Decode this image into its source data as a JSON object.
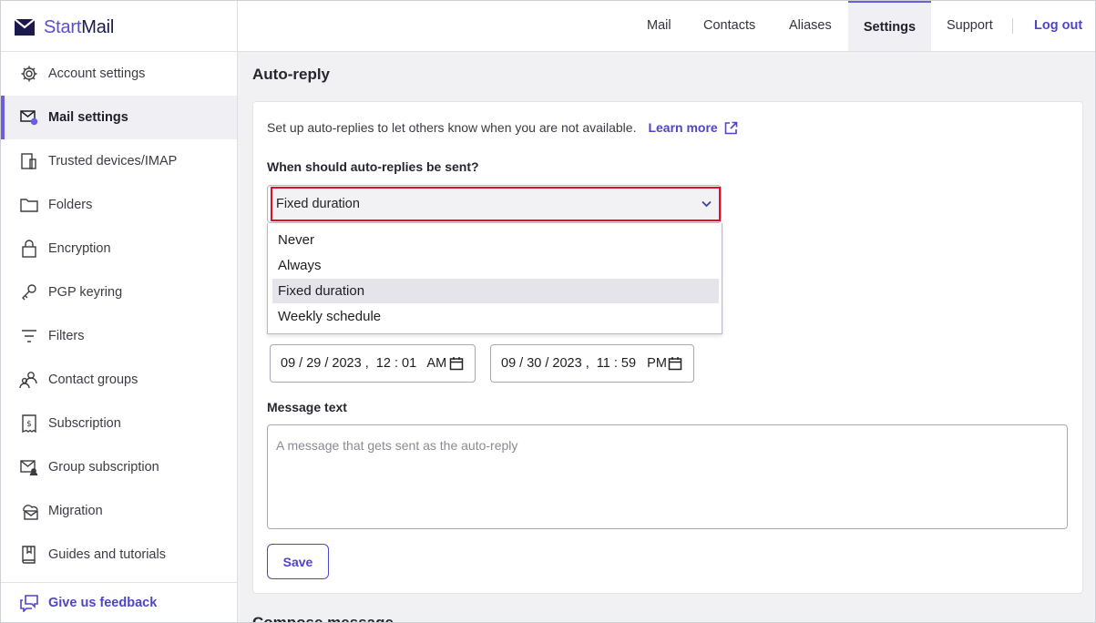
{
  "brand": {
    "name_start": "Start",
    "name_end": "Mail"
  },
  "top_nav": {
    "items": [
      "Mail",
      "Contacts",
      "Aliases",
      "Settings",
      "Support"
    ],
    "logout": "Log out"
  },
  "sidebar": {
    "items": [
      {
        "label": "Account settings",
        "icon": "gear-icon"
      },
      {
        "label": "Mail settings",
        "icon": "mail-settings-icon"
      },
      {
        "label": "Trusted devices/IMAP",
        "icon": "devices-icon"
      },
      {
        "label": "Folders",
        "icon": "folder-icon"
      },
      {
        "label": "Encryption",
        "icon": "lock-icon"
      },
      {
        "label": "PGP keyring",
        "icon": "key-icon"
      },
      {
        "label": "Filters",
        "icon": "filter-icon"
      },
      {
        "label": "Contact groups",
        "icon": "contact-groups-icon"
      },
      {
        "label": "Subscription",
        "icon": "subscription-icon"
      },
      {
        "label": "Group subscription",
        "icon": "group-subscription-icon"
      },
      {
        "label": "Migration",
        "icon": "migration-icon"
      },
      {
        "label": "Guides and tutorials",
        "icon": "book-icon"
      }
    ],
    "active_index": 1,
    "feedback": "Give us feedback"
  },
  "autoreply": {
    "title": "Auto-reply",
    "intro": "Set up auto-replies to let others know when you are not available.",
    "learn_more": "Learn more",
    "question": "When should auto-replies be sent?",
    "selected": "Fixed duration",
    "options": [
      "Never",
      "Always",
      "Fixed duration",
      "Weekly schedule"
    ],
    "start": "09 / 29 / 2023 ,  12 : 01   AM",
    "end": "09 / 30 / 2023 ,  11 : 59   PM",
    "message_label": "Message text",
    "message_placeholder": "A message that gets sent as the auto-reply",
    "save": "Save"
  },
  "next_section": {
    "title": "Compose message"
  },
  "colors": {
    "accent": "#4e45c8",
    "highlight": "#e0102a"
  }
}
